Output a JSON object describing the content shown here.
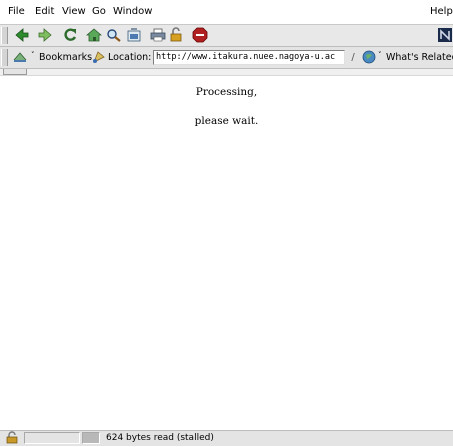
{
  "menubar": {
    "items": [
      "File",
      "Edit",
      "View",
      "Go",
      "Window"
    ],
    "help": "Help"
  },
  "toolbar": {
    "buttons": [
      "back-icon",
      "forward-icon",
      "reload-icon",
      "home-icon",
      "search-icon",
      "my-netscape-icon",
      "print-icon",
      "security-icon",
      "stop-icon"
    ],
    "throbber": "netscape-logo-icon"
  },
  "locationbar": {
    "bookmarks_label": "Bookmarks",
    "location_label": "Location:",
    "url": "http://www.itakura.nuee.nagoya-u.ac",
    "whats_related_label": "What's Related"
  },
  "content": {
    "line1": "Processing,",
    "line2": "please wait."
  },
  "statusbar": {
    "text": "624 bytes read (stalled)"
  },
  "colors": {
    "chrome_bg": "#e4e4e4",
    "icon_green": "#2e8b2e",
    "page_bg": "#ffffff"
  }
}
